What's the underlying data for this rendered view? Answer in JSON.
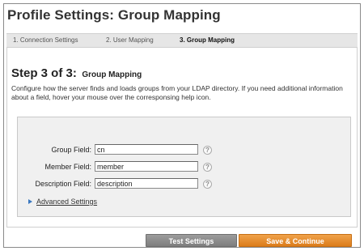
{
  "page": {
    "title": "Profile Settings: Group Mapping"
  },
  "tabs": [
    {
      "label": "1. Connection Settings",
      "active": false
    },
    {
      "label": "2. User Mapping",
      "active": false
    },
    {
      "label": "3. Group Mapping",
      "active": true
    }
  ],
  "step": {
    "number": "Step 3 of 3:",
    "name": "Group Mapping",
    "description": "Configure how the server finds and loads groups from your LDAP directory. If you need additional information about a field, hover your mouse over the corresponsing help icon."
  },
  "form": {
    "group_field": {
      "label": "Group Field:",
      "value": "cn"
    },
    "member_field": {
      "label": "Member Field:",
      "value": "member"
    },
    "description_field": {
      "label": "Description Field:",
      "value": "description"
    },
    "help_glyph": "?",
    "advanced_label": "Advanced Settings"
  },
  "buttons": {
    "test_label": "Test Settings",
    "save_label": "Save & Continue"
  },
  "colors": {
    "accent_orange": "#e08a2a",
    "button_gray": "#8a8a8a",
    "link_blue": "#3a78c0"
  }
}
